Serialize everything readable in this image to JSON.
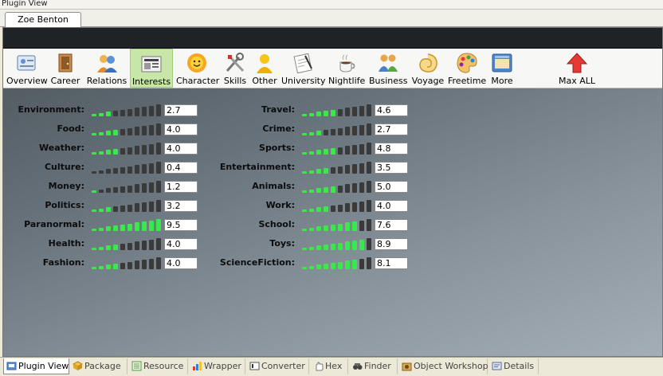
{
  "window": {
    "title": "Plugin View"
  },
  "document_tab": {
    "label": "Zoe Benton"
  },
  "toolbar": {
    "items": [
      {
        "label": "Overview",
        "icon": "overview-icon"
      },
      {
        "label": "Career",
        "icon": "career-icon"
      },
      {
        "label": "Relations",
        "icon": "relations-icon"
      },
      {
        "label": "Interests",
        "icon": "interests-icon",
        "active": true
      },
      {
        "label": "Character",
        "icon": "character-icon"
      },
      {
        "label": "Skills",
        "icon": "skills-icon"
      },
      {
        "label": "Other",
        "icon": "other-icon"
      },
      {
        "label": "University",
        "icon": "university-icon"
      },
      {
        "label": "Nightlife",
        "icon": "nightlife-icon"
      },
      {
        "label": "Business",
        "icon": "business-icon"
      },
      {
        "label": "Voyage",
        "icon": "voyage-icon"
      },
      {
        "label": "Freetime",
        "icon": "freetime-icon"
      },
      {
        "label": "More",
        "icon": "more-icon"
      },
      {
        "label": "Max ALL",
        "icon": "max-all-icon"
      }
    ]
  },
  "interests": {
    "left": [
      {
        "name": "Environment:",
        "value": "2.7"
      },
      {
        "name": "Food:",
        "value": "4.0"
      },
      {
        "name": "Weather:",
        "value": "4.0"
      },
      {
        "name": "Culture:",
        "value": "0.4"
      },
      {
        "name": "Money:",
        "value": "1.2"
      },
      {
        "name": "Politics:",
        "value": "3.2"
      },
      {
        "name": "Paranormal:",
        "value": "9.5"
      },
      {
        "name": "Health:",
        "value": "4.0"
      },
      {
        "name": "Fashion:",
        "value": "4.0"
      }
    ],
    "right": [
      {
        "name": "Travel:",
        "value": "4.6"
      },
      {
        "name": "Crime:",
        "value": "2.7"
      },
      {
        "name": "Sports:",
        "value": "4.8"
      },
      {
        "name": "Entertainment:",
        "value": "3.5"
      },
      {
        "name": "Animals:",
        "value": "5.0"
      },
      {
        "name": "Work:",
        "value": "4.0"
      },
      {
        "name": "School:",
        "value": "7.6"
      },
      {
        "name": "Toys:",
        "value": "8.9"
      },
      {
        "name": "ScienceFiction:",
        "value": "8.1"
      }
    ],
    "scale_max": 10,
    "bar_color_on": "#39e84a",
    "bar_color_off": "#3a3a3a"
  },
  "bottom_tabs": [
    {
      "label": "Plugin View",
      "icon": "plugin-view-icon",
      "active": true
    },
    {
      "label": "Package",
      "icon": "package-icon"
    },
    {
      "label": "Resource",
      "icon": "resource-icon"
    },
    {
      "label": "Wrapper",
      "icon": "wrapper-icon"
    },
    {
      "label": "Converter",
      "icon": "converter-icon"
    },
    {
      "label": "Hex",
      "icon": "hex-icon"
    },
    {
      "label": "Finder",
      "icon": "finder-icon"
    },
    {
      "label": "Object Workshop",
      "icon": "object-workshop-icon"
    },
    {
      "label": "Details",
      "icon": "details-icon"
    }
  ]
}
